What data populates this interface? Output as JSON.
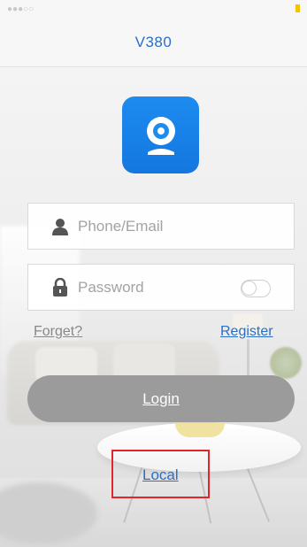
{
  "header": {
    "title": "V380"
  },
  "status_bar": {
    "battery_color": "#f5c400"
  },
  "app": {
    "logo_icon": "camera-icon",
    "brand_color": "#1d8bf0"
  },
  "login_form": {
    "phone_email": {
      "placeholder": "Phone/Email",
      "value": "",
      "icon": "user-icon"
    },
    "password": {
      "placeholder": "Password",
      "value": "",
      "icon": "lock-icon",
      "show_toggle": false
    },
    "forget_label": "Forget?",
    "register_label": "Register",
    "login_label": "Login",
    "local_label": "Local"
  },
  "annotation": {
    "highlight_color": "#e0262b"
  }
}
